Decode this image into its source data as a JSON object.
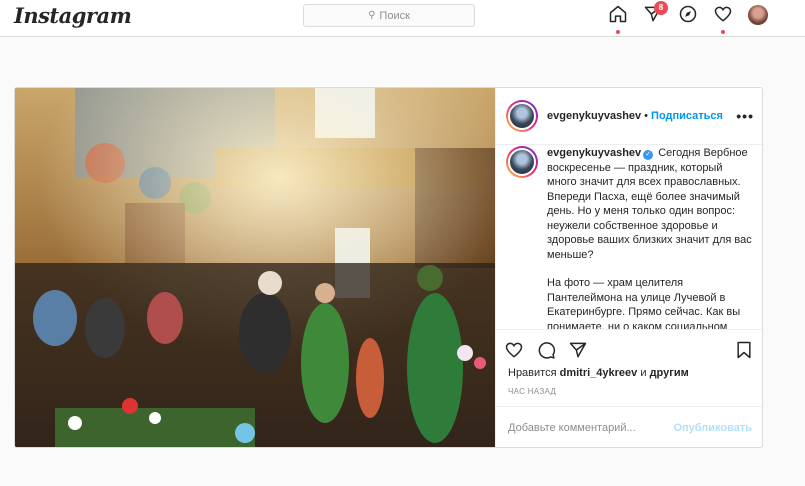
{
  "header": {
    "logo": "Instagram",
    "search_placeholder": "Поиск",
    "notifications_count": "8"
  },
  "post": {
    "username": "evgenykuyvashev",
    "separator": "•",
    "follow_label": "Подписаться",
    "more_label": "•••",
    "caption_username": "evgenykuyvashev",
    "caption_p1": "Сегодня Вербное воскресенье — праздник, который много значит для всех православных. Впереди Пасха, ещё более значимый день. Но у меня только один вопрос: неужели собственное здоровье и здоровье ваших близких значит для вас меньше?",
    "caption_p2": "На фото — храм целителя Пантелеймона на улице Лучевой в Екатеринбурге. Прямо сейчас. Как вы понимаете, ни о каком социальном",
    "likes_prefix": "Нравится",
    "likes_user": "dmitri_4ykreev",
    "likes_and": "и",
    "likes_others": "другим",
    "time_ago": "ЧАС НАЗАД",
    "comment_placeholder": "Добавьте комментарий...",
    "publish_label": "Опубликовать"
  },
  "colors": {
    "accent": "#0095f6",
    "notification": "#ed4956",
    "verified": "#3897f0"
  }
}
